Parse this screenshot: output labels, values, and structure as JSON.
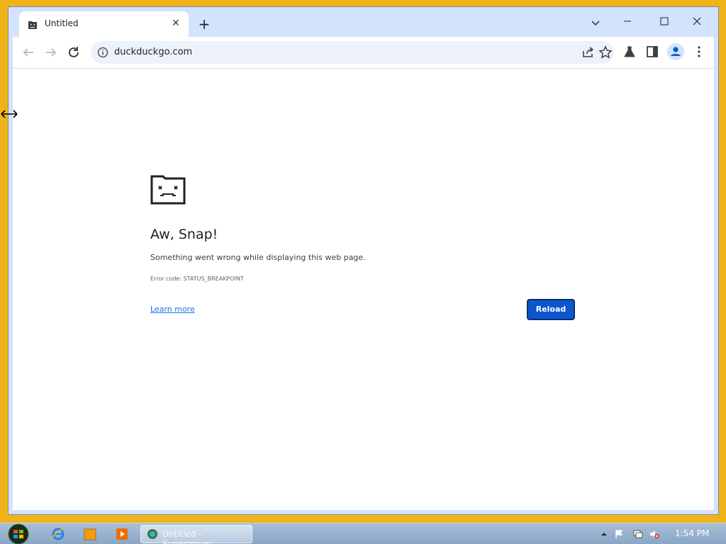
{
  "browser": {
    "tab": {
      "title": "Untitled",
      "close_glyph": "✕"
    },
    "new_tab_glyph": "+",
    "omnibox": {
      "url": "duckduckgo.com"
    }
  },
  "error_page": {
    "title": "Aw, Snap!",
    "message": "Something went wrong while displaying this web page.",
    "error_code": "Error code: STATUS_BREAKPOINT",
    "learn_more": "Learn more",
    "reload": "Reload"
  },
  "taskbar": {
    "task_label": "Untitled - Supermium",
    "clock": "1:54 PM"
  },
  "colors": {
    "desktop": "#f0b418",
    "tabstrip": "#d3e3fd",
    "reload_button": "#0b57d0"
  }
}
